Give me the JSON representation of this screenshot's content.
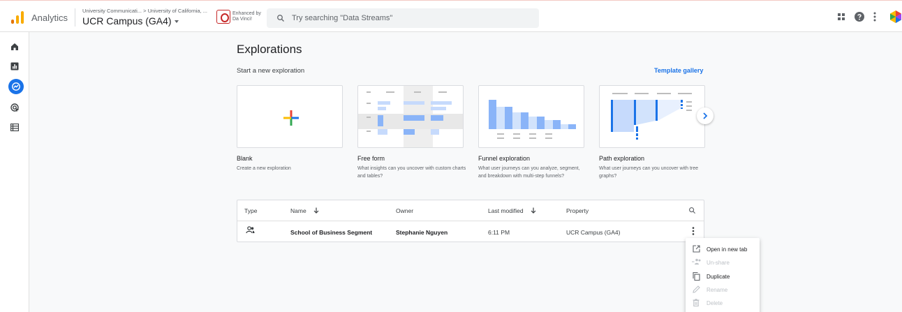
{
  "header": {
    "app_name": "Analytics",
    "breadcrumb": "University Communicati... > University of California, ...",
    "property": "UCR Campus (GA4)",
    "extension_text": "Enhanced by Da Vinci!",
    "search_placeholder": "Try searching \"Data Streams\""
  },
  "page": {
    "title": "Explorations",
    "subhead": "Start a new exploration",
    "template_gallery": "Template gallery"
  },
  "templates": [
    {
      "title": "Blank",
      "desc": "Create a new exploration"
    },
    {
      "title": "Free form",
      "desc": "What insights can you uncover with custom charts and tables?"
    },
    {
      "title": "Funnel exploration",
      "desc": "What user journeys can you analyze, segment, and breakdown with multi-step funnels?"
    },
    {
      "title": "Path exploration",
      "desc": "What user journeys can you uncover with tree graphs?"
    }
  ],
  "table": {
    "headers": {
      "type": "Type",
      "name": "Name",
      "owner": "Owner",
      "last_modified": "Last modified",
      "property": "Property"
    },
    "rows": [
      {
        "name": "School of Business Segment",
        "owner": "Stephanie Nguyen",
        "last_modified": "6:11 PM",
        "property": "UCR Campus (GA4)"
      }
    ]
  },
  "menu": {
    "open_new_tab": "Open in new tab",
    "unshare": "Un-share",
    "duplicate": "Duplicate",
    "rename": "Rename",
    "delete": "Delete"
  },
  "colors": {
    "accent": "#1a73e8",
    "logo_orange": "#f9ab00",
    "logo_dark": "#e37400"
  }
}
